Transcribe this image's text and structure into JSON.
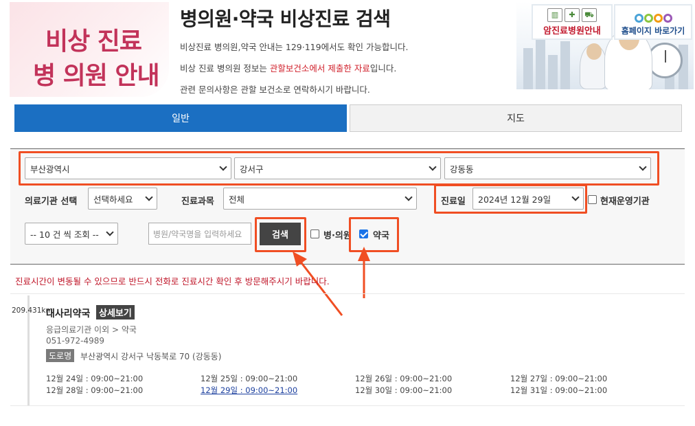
{
  "header": {
    "logo_line1": "비상 진료",
    "logo_line2": "병 의원 안내",
    "title": "병의원·약국 비상진료 검색",
    "info1": "비상진료 병의원,약국 안내는 129·119에서도 확인 가능합니다.",
    "info2_pre": "비상 진료 병의원 정보는 ",
    "info2_red": "관할보건소에서 제출한 자료",
    "info2_post": "입니다.",
    "info3": "관련 문의사항은 관할 보건소로 연락하시기 바랍니다.",
    "cancer_button": "암진료병원안내",
    "home_button": "홈페이지 바로가기"
  },
  "tabs": [
    {
      "label": "일반",
      "active": true
    },
    {
      "label": "지도",
      "active": false
    }
  ],
  "search": {
    "city": "부산광역시",
    "district": "강서구",
    "dong": "강동동",
    "institution_label": "의료기관 선택",
    "institution_value": "선택하세요",
    "department_label": "진료과목",
    "department_value": "전체",
    "date_label": "진료일",
    "date_value": "2024년 12월 29일",
    "open_now_label": "현재운영기관",
    "open_now_checked": false,
    "page_size": "-- 10 건 씩 조회 --",
    "name_placeholder": "병원/약국명을 입력하세요",
    "search_button": "검색",
    "hospital_label": "병·의원",
    "hospital_checked": false,
    "pharmacy_label": "약국",
    "pharmacy_checked": true
  },
  "notice": "진료시간이 변동될 수 있으므로 반드시 전화로 진료시간 확인 후 방문해주시기 바랍니다.",
  "results": [
    {
      "distance": "209.431km",
      "name": "대사리약국",
      "detail_button": "상세보기",
      "category": "응급의료기관 이외 > 약국",
      "phone": "051-972-4989",
      "road_label": "도로명",
      "address": "부산광역시 강서구 낙동북로 70 (강동동)",
      "hours": [
        "12월 24일 : 09:00~21:00",
        "12월 25일 : 09:00~21:00",
        "12월 26일 : 09:00~21:00",
        "12월 27일 : 09:00~21:00",
        "12월 28일 : 09:00~21:00",
        "12월 29일 : 09:00~21:00",
        "12월 30일 : 09:00~21:00",
        "12월 31일 : 09:00~21:00"
      ],
      "highlighted_day_index": 5
    }
  ],
  "colors": {
    "tab_active": "#1b6fc2",
    "highlight": "#f04e23",
    "notice_red": "#c0172a",
    "logo_pink": "#c2335a"
  }
}
